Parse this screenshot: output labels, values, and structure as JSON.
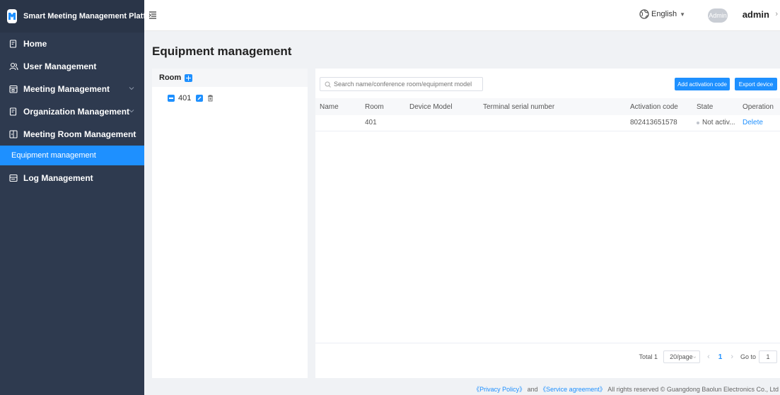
{
  "brand": {
    "title": "Smart Meeting Management Platform"
  },
  "sidebar": {
    "items": [
      {
        "label": "Home"
      },
      {
        "label": "User Management"
      },
      {
        "label": "Meeting Management"
      },
      {
        "label": "Organization Management"
      },
      {
        "label": "Meeting Room Management"
      },
      {
        "label": "Equipment management"
      },
      {
        "label": "Log Management"
      }
    ]
  },
  "header": {
    "language": "English",
    "avatar_text": "Admin",
    "username": "admin",
    "more_arrow": "›"
  },
  "page": {
    "title": "Equipment management"
  },
  "tree": {
    "header": "Room",
    "nodes": [
      {
        "label": "401"
      }
    ]
  },
  "toolbar": {
    "search_placeholder": "Search name/conference room/equipment model",
    "add_label": "Add activation code",
    "export_label": "Export device"
  },
  "table": {
    "columns": [
      "Name",
      "Room",
      "Device Model",
      "Terminal serial number",
      "Activation code",
      "State",
      "Operation"
    ],
    "rows": [
      {
        "name": "",
        "room": "401",
        "device_model": "",
        "serial": "",
        "activation_code": "802413651578",
        "state": "Not activ...",
        "operation": "Delete"
      }
    ]
  },
  "pagination": {
    "total_label": "Total 1",
    "page_size": "20/page",
    "prev": "‹",
    "current_page": "1",
    "next": "›",
    "goto_label": "Go to",
    "goto_value": "1"
  },
  "footer": {
    "privacy": "《Privacy Policy》",
    "and": "and",
    "service": "《Service agreement》",
    "rights": "All rights reserved © Guangdong Baolun Electronics Co., Ltd"
  },
  "colors": {
    "accent": "#1e90ff",
    "sidebar_bg": "#2e3a4f"
  }
}
